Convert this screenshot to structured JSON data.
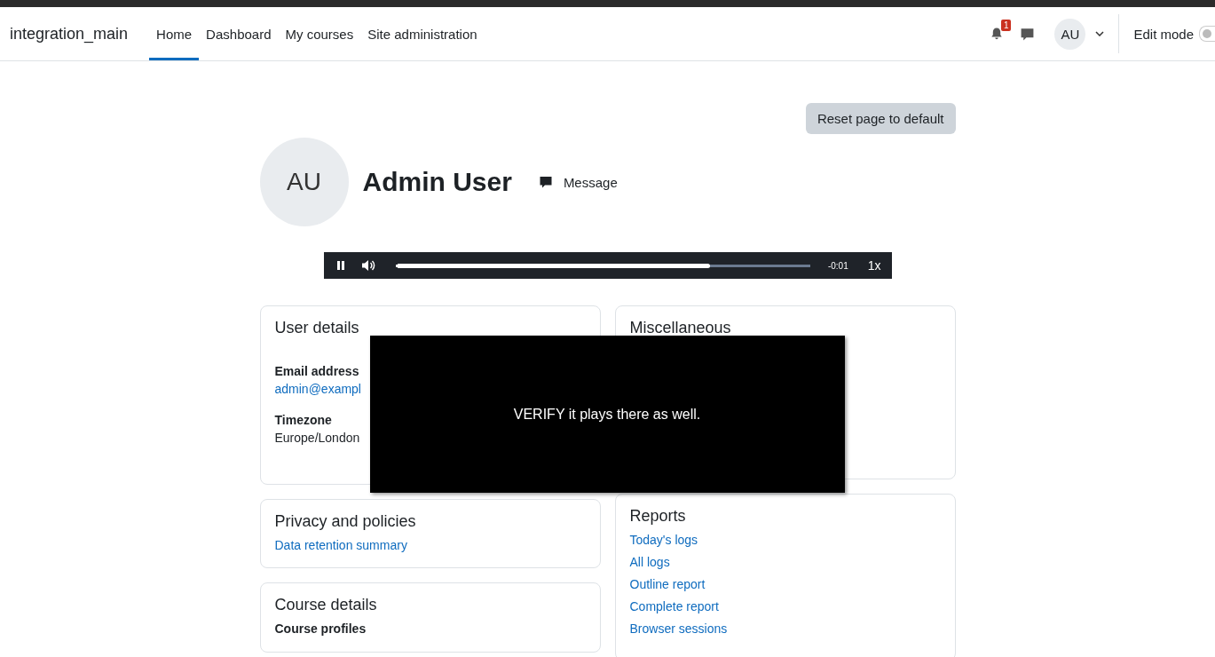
{
  "navbar": {
    "brand": "integration_main",
    "items": [
      {
        "label": "Home",
        "selected": true
      },
      {
        "label": "Dashboard",
        "selected": false
      },
      {
        "label": "My courses",
        "selected": false
      },
      {
        "label": "Site administration",
        "selected": false
      }
    ],
    "notification_count": "1",
    "avatar_initials": "AU",
    "edit_mode": {
      "label": "Edit mode",
      "on": false
    }
  },
  "reset_button": "Reset page to default",
  "profile": {
    "initials": "AU",
    "name": "Admin User",
    "message_label": "Message"
  },
  "media_player": {
    "playing": true,
    "level": 0.75,
    "time": "-0:01",
    "speed": "1x"
  },
  "left_cards": [
    {
      "title": "User details",
      "fields": [
        {
          "label": "Email address",
          "value": "admin@exampl",
          "kind": "link"
        },
        {
          "label": "Timezone",
          "value": "Europe/London",
          "kind": "text"
        }
      ]
    },
    {
      "title": "Privacy and policies",
      "links": [
        "Data retention summary"
      ]
    },
    {
      "title": "Course details",
      "fields": [
        {
          "label": "Course profiles"
        }
      ]
    }
  ],
  "right_cards": [
    {
      "title": "Miscellaneous"
    },
    {
      "title": "Reports",
      "links": [
        "Today's logs",
        "All logs",
        "Outline report",
        "Complete report",
        "Browser sessions"
      ]
    }
  ],
  "overlay": {
    "text": "VERIFY it plays there as well."
  }
}
